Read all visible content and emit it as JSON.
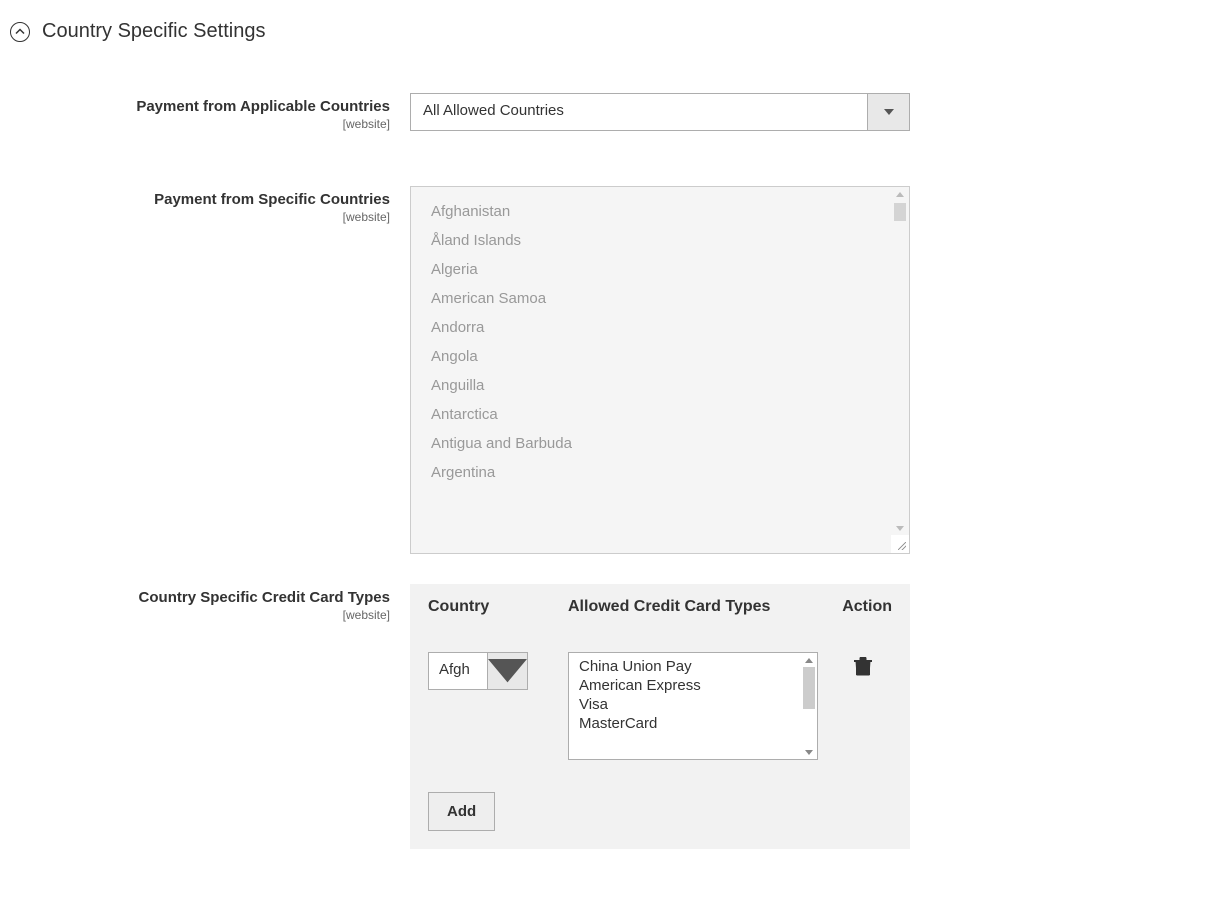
{
  "section_title": "Country Specific Settings",
  "scope_label": "[website]",
  "fields": {
    "applicable_countries": {
      "label": "Payment from Applicable Countries",
      "value": "All Allowed Countries"
    },
    "specific_countries": {
      "label": "Payment from Specific Countries",
      "options": [
        "Afghanistan",
        "Åland Islands",
        "Algeria",
        "American Samoa",
        "Andorra",
        "Angola",
        "Anguilla",
        "Antarctica",
        "Antigua and Barbuda",
        "Argentina"
      ]
    },
    "card_types": {
      "label": "Country Specific Credit Card Types",
      "headers": {
        "country": "Country",
        "cards": "Allowed Credit Card Types",
        "action": "Action"
      },
      "row": {
        "country_value": "Afgh",
        "card_options": [
          "China Union Pay",
          "American Express",
          "Visa",
          "MasterCard"
        ]
      },
      "add_button": "Add"
    }
  }
}
